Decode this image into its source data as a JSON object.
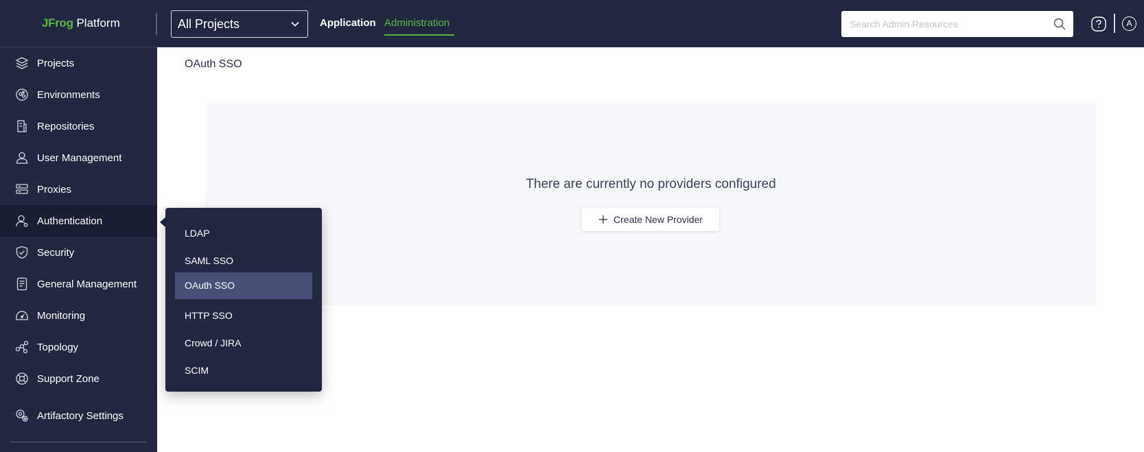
{
  "header": {
    "logo_brand": "JFrog",
    "logo_product": "Platform",
    "project_select_value": "All Projects",
    "nav": [
      {
        "label": "Application",
        "active": false
      },
      {
        "label": "Administration",
        "active": true
      }
    ],
    "search_placeholder": "Search Admin Resources",
    "avatar_initial": "A"
  },
  "sidebar": {
    "items": [
      {
        "label": "Projects",
        "icon": "projects-icon"
      },
      {
        "label": "Environments",
        "icon": "environments-icon"
      },
      {
        "label": "Repositories",
        "icon": "repositories-icon"
      },
      {
        "label": "User Management",
        "icon": "user-icon"
      },
      {
        "label": "Proxies",
        "icon": "proxies-icon"
      },
      {
        "label": "Authentication",
        "icon": "authentication-icon",
        "active": true
      },
      {
        "label": "Security",
        "icon": "shield-icon"
      },
      {
        "label": "General Management",
        "icon": "document-icon"
      },
      {
        "label": "Monitoring",
        "icon": "monitoring-icon"
      },
      {
        "label": "Topology",
        "icon": "topology-icon"
      },
      {
        "label": "Support Zone",
        "icon": "lifebuoy-icon"
      },
      {
        "label": "Artifactory Settings",
        "icon": "settings-icon"
      }
    ]
  },
  "flyout": {
    "items": [
      {
        "label": "LDAP"
      },
      {
        "label": "SAML SSO"
      },
      {
        "label": "OAuth SSO",
        "selected": true
      },
      {
        "label": "HTTP SSO"
      },
      {
        "label": "Crowd / JIRA"
      },
      {
        "label": "SCIM"
      }
    ]
  },
  "main": {
    "title": "OAuth SSO",
    "empty_message": "There are currently no providers configured",
    "create_button_label": "Create New Provider"
  },
  "colors": {
    "brand_green": "#5bb446",
    "header_bg": "#232841",
    "selected_bg": "#485078"
  }
}
